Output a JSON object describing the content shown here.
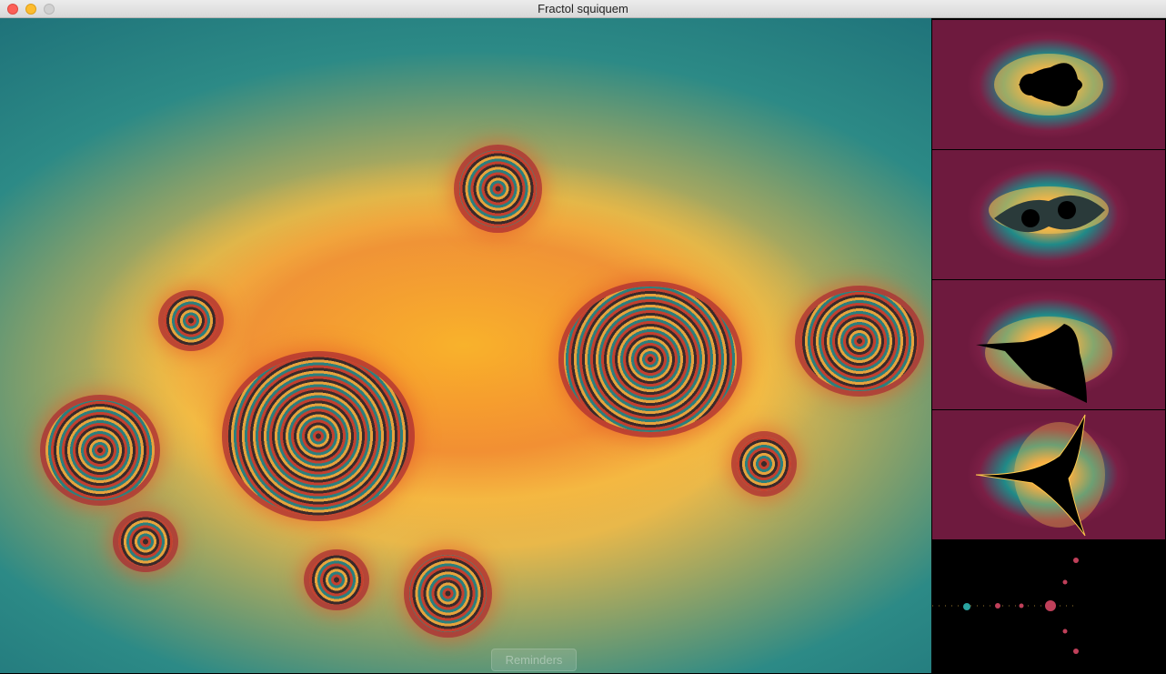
{
  "window": {
    "title": "Fractol squiquem"
  },
  "main_view": {
    "fractal": "julia-spiral"
  },
  "sidebar": {
    "thumbnails": [
      {
        "fractal": "mandelbrot"
      },
      {
        "fractal": "julia-variant"
      },
      {
        "fractal": "burning-ship"
      },
      {
        "fractal": "tricorn"
      },
      {
        "fractal": "dots"
      }
    ]
  },
  "footer": {
    "reminders_label": "Reminders"
  },
  "colors": {
    "teal": "#1d7f80",
    "orange": "#f5a73b",
    "crimson": "#b3283b",
    "maroon": "#6e1a3e"
  }
}
